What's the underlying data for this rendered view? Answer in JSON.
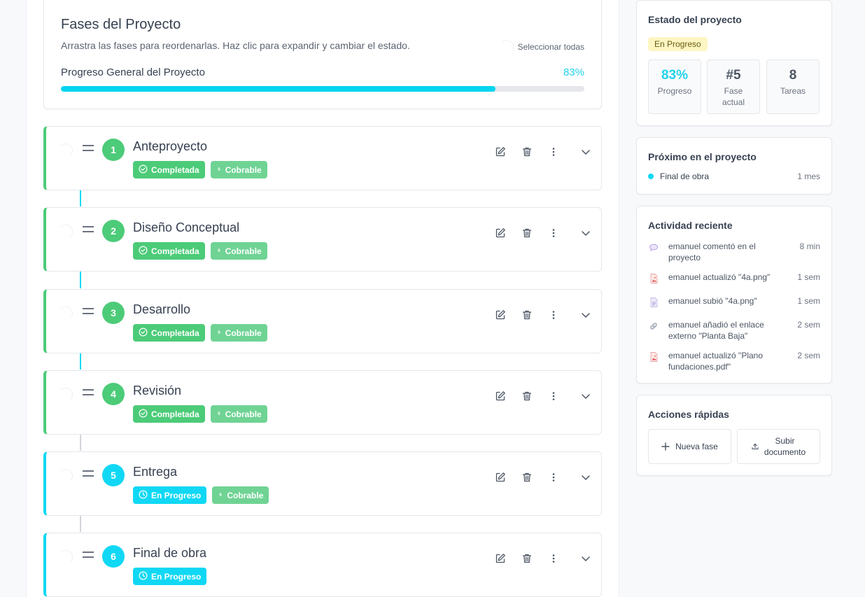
{
  "header": {
    "title": "Fases del Proyecto",
    "subtitle": "Arrastra las fases para reordenarlas. Haz clic para expandir y cambiar el estado.",
    "select_all": "Seleccionar todas",
    "progress_label": "Progreso General del Proyecto",
    "progress_text": "83%",
    "progress_value": 0.83
  },
  "phases": [
    {
      "number": "1",
      "title": "Anteproyecto",
      "status": "Completada",
      "billable": "Cobrable"
    },
    {
      "number": "2",
      "title": "Diseño Conceptual",
      "status": "Completada",
      "billable": "Cobrable"
    },
    {
      "number": "3",
      "title": "Desarrollo",
      "status": "Completada",
      "billable": "Cobrable"
    },
    {
      "number": "4",
      "title": "Revisión",
      "status": "Completada",
      "billable": "Cobrable"
    },
    {
      "number": "5",
      "title": "Entrega",
      "status": "En Progreso",
      "billable": "Cobrable"
    },
    {
      "number": "6",
      "title": "Final de obra",
      "status": "En Progreso",
      "billable": ""
    }
  ],
  "status_card": {
    "title": "Estado del proyecto",
    "status": "En Progreso",
    "stats": [
      {
        "value": "83%",
        "label": "Progreso"
      },
      {
        "value": "#5",
        "label": "Fase actual"
      },
      {
        "value": "8",
        "label": "Tareas"
      }
    ]
  },
  "next_card": {
    "title": "Próximo en el proyecto",
    "item": "Final de obra",
    "time": "1 mes"
  },
  "activity": {
    "title": "Actividad reciente",
    "items": [
      {
        "icon": "comment-icon",
        "text": "emanuel comentó en el proyecto",
        "time": "8 min"
      },
      {
        "icon": "file-image-icon",
        "text": "emanuel actualizó \"4a.png\"",
        "time": "1 sem"
      },
      {
        "icon": "file-icon",
        "text": "emanuel subió \"4a.png\"",
        "time": "1 sem"
      },
      {
        "icon": "link-icon",
        "text": "emanuel añadió el enlace externo \"Planta Baja\"",
        "time": "2 sem"
      },
      {
        "icon": "file-pdf-icon",
        "text": "emanuel actualizó \"Plano fundaciones.pdf\"",
        "time": "2 sem"
      }
    ]
  },
  "quick_actions": {
    "title": "Acciones rápidas",
    "new_phase": "Nueva fase",
    "upload_doc": "Subir documento"
  },
  "colors": {
    "completed": "#4ccb78",
    "in_progress": "#10d8f4",
    "billable": "#6fd394",
    "accent": "#22d3ee",
    "pending_connector": "#d1d5db"
  }
}
